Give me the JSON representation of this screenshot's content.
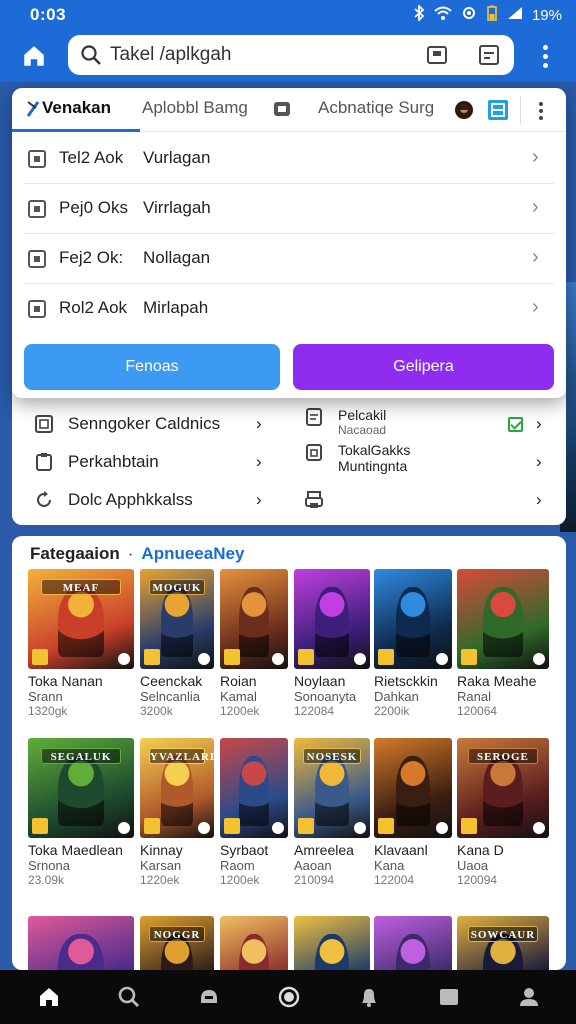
{
  "status_bar": {
    "time": "0:03",
    "battery": "19%",
    "icons": [
      "bluetooth-icon",
      "wifi-icon",
      "settings-icon",
      "battery-icon",
      "signal-icon"
    ]
  },
  "app_bar": {
    "search_value": "Takel /aplkgah"
  },
  "dropdown": {
    "tabs": [
      {
        "label": "Venakan",
        "active": true
      },
      {
        "label": "Aplobbl Bamg",
        "active": false
      },
      {
        "label": "Acbnatiqe Surg",
        "active": false
      }
    ],
    "rows": [
      {
        "c1": "Tel2 Aok",
        "c2": "Vurlagan"
      },
      {
        "c1": "Pej0 Oks",
        "c2": "Virrlagah"
      },
      {
        "c1": "Fej2 Ok:",
        "c2": "Nollagan"
      },
      {
        "c1": "Rol2 Aok",
        "c2": "Mirlapah"
      }
    ],
    "buttons": {
      "primary": "Fenoas",
      "secondary": "Gelipera"
    }
  },
  "quick_links": {
    "left": [
      "Senngoker Caldnics",
      "Perkahbtain",
      "Dolc Apphkkalss"
    ],
    "right": [
      {
        "title": "Pelcakil",
        "subtitle": "Nacaoad"
      },
      {
        "title": "TokalGakks",
        "subtitle": "Muntingnta"
      },
      {
        "title": "",
        "subtitle": ""
      }
    ]
  },
  "games_section": {
    "title": "Fategaaion",
    "subtitle": "ApnueeaNey",
    "games": [
      {
        "title": "Toka Nanan",
        "publisher": "Srann",
        "size": "1320gk",
        "palette": [
          "#c8402a",
          "#f2b13a"
        ],
        "banner": "MEAF"
      },
      {
        "title": "Ceenckak",
        "publisher": "Selncanlia",
        "size": "3200k",
        "palette": [
          "#2a3d6a",
          "#e8a431"
        ],
        "banner": "MOGUK"
      },
      {
        "title": "Roian",
        "publisher": "Kamal",
        "size": "1200ek",
        "palette": [
          "#6b2e1c",
          "#e6913c"
        ],
        "banner": ""
      },
      {
        "title": "Noylaan",
        "publisher": "Sonoanyta",
        "size": "122084",
        "palette": [
          "#3b1f78",
          "#c13fe0"
        ],
        "banner": ""
      },
      {
        "title": "Rietsckkin",
        "publisher": "Dahkan",
        "size": "2200ik",
        "palette": [
          "#0e2a4e",
          "#2f8be0"
        ],
        "banner": ""
      },
      {
        "title": "Raka Meahe",
        "publisher": "Ranal",
        "size": "120064",
        "palette": [
          "#2f6a2a",
          "#d84a3b"
        ],
        "banner": ""
      },
      {
        "title": "Toka Maedlean",
        "publisher": "Srnona",
        "size": "23.09k",
        "palette": [
          "#1e4a2e",
          "#5fae3a"
        ],
        "banner": "SEGALUK"
      },
      {
        "title": "Kinnay",
        "publisher": "Karsan",
        "size": "1220ek",
        "palette": [
          "#b0592a",
          "#f5cf52"
        ],
        "banner": "YVAZLARE"
      },
      {
        "title": "Syrbaot",
        "publisher": "Raom",
        "size": "1200ek",
        "palette": [
          "#2a4a8a",
          "#c84848"
        ],
        "banner": ""
      },
      {
        "title": "Amreelea",
        "publisher": "Aaoan",
        "size": "210094",
        "palette": [
          "#3a5a8a",
          "#f0b93a"
        ],
        "banner": "NOSESK"
      },
      {
        "title": "Klavaanl",
        "publisher": "Kana",
        "size": "122004",
        "palette": [
          "#3a1e12",
          "#d47a2a"
        ],
        "banner": ""
      },
      {
        "title": "Kana D",
        "publisher": "Uaoa",
        "size": "120094",
        "palette": [
          "#5a1e1e",
          "#c97a3a"
        ],
        "banner": "SEROGE"
      }
    ],
    "peek_row": [
      {
        "palette": [
          "#4a2a8a",
          "#e05a9a"
        ],
        "banner": ""
      },
      {
        "palette": [
          "#2a1a1a",
          "#e0a030"
        ],
        "banner": "NOGGR"
      },
      {
        "palette": [
          "#8a2a2a",
          "#f0c060"
        ],
        "banner": ""
      },
      {
        "palette": [
          "#1a3a6a",
          "#f0c040"
        ],
        "banner": ""
      },
      {
        "palette": [
          "#3a2a6a",
          "#c060e0"
        ],
        "banner": ""
      },
      {
        "palette": [
          "#1a1a3a",
          "#e0b040"
        ],
        "banner": "SOWCAUR"
      }
    ]
  },
  "bottom_nav": [
    "home-icon",
    "search-icon",
    "games-icon",
    "circle-icon",
    "bell-icon",
    "square-icon",
    "profile-icon"
  ]
}
